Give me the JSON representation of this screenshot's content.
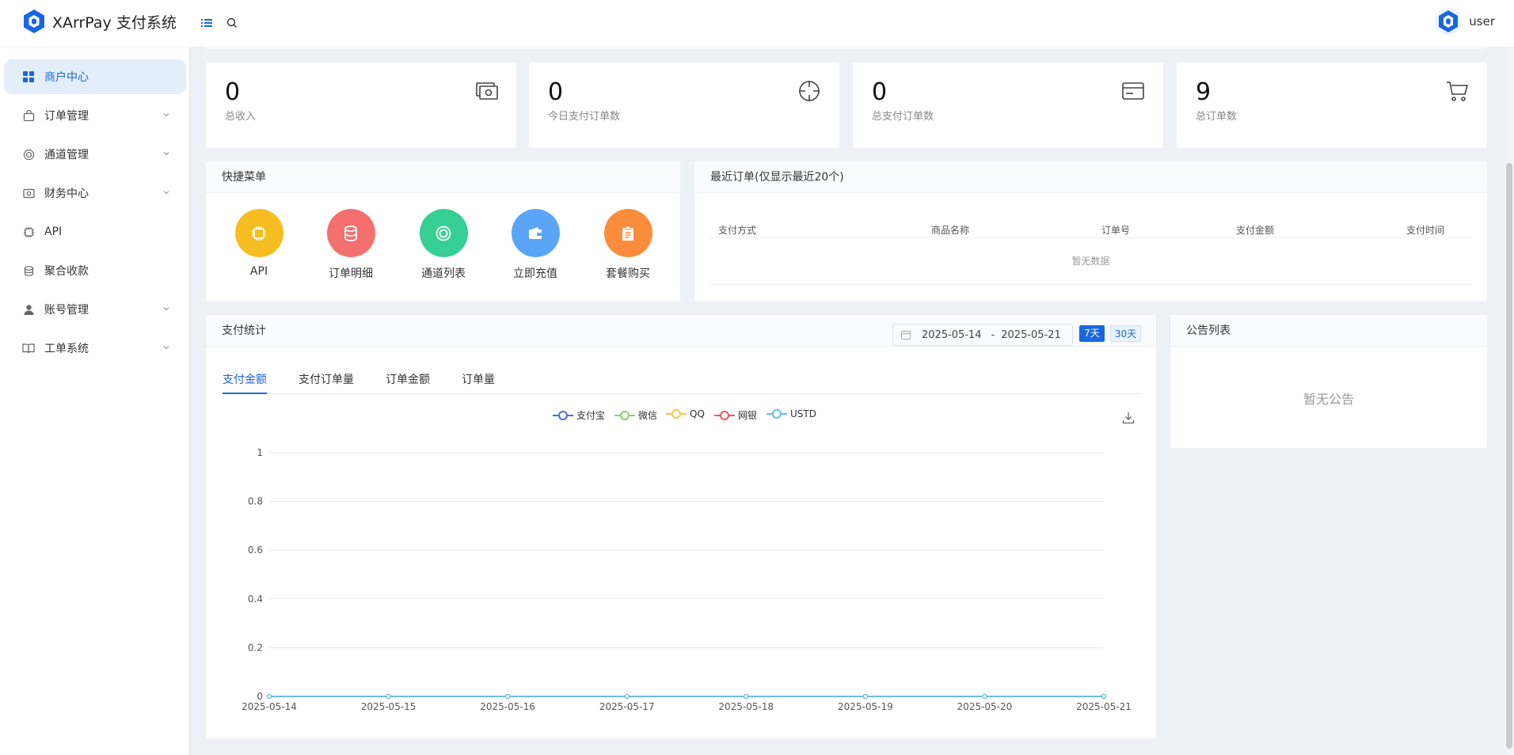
{
  "app": {
    "title": "XArrPay 支付系统",
    "user": "user",
    "brand_color": "#1a66e0"
  },
  "sidebar": {
    "items": [
      {
        "label": "商户中心",
        "icon": "grid-icon",
        "active": true
      },
      {
        "label": "订单管理",
        "icon": "bag-icon",
        "has_children": true
      },
      {
        "label": "通道管理",
        "icon": "ring-icon",
        "has_children": true
      },
      {
        "label": "财务中心",
        "icon": "money-icon",
        "has_children": true
      },
      {
        "label": "API",
        "icon": "chip-icon"
      },
      {
        "label": "聚合收款",
        "icon": "coins-icon"
      },
      {
        "label": "账号管理",
        "icon": "user-icon",
        "has_children": true
      },
      {
        "label": "工单系统",
        "icon": "book-icon",
        "has_children": true
      }
    ]
  },
  "stats": [
    {
      "value": "0",
      "label": "总收入",
      "icon": "money-stack-icon"
    },
    {
      "value": "0",
      "label": "今日支付订单数",
      "icon": "crosshair-icon"
    },
    {
      "value": "0",
      "label": "总支付订单数",
      "icon": "card-icon"
    },
    {
      "value": "9",
      "label": "总订单数",
      "icon": "cart-icon"
    }
  ],
  "quick_menu": {
    "title": "快捷菜单",
    "items": [
      {
        "label": "API",
        "color": "#f5bd1f",
        "icon": "chip-icon"
      },
      {
        "label": "订单明细",
        "color": "#f4706f",
        "icon": "database-icon"
      },
      {
        "label": "通道列表",
        "color": "#36cf96",
        "icon": "ring-icon"
      },
      {
        "label": "立即充值",
        "color": "#5ba5f8",
        "icon": "wallet-icon"
      },
      {
        "label": "套餐购买",
        "color": "#fb8c3b",
        "icon": "clipboard-icon"
      }
    ]
  },
  "recent_orders": {
    "title": "最近订单(仅显示最近20个)",
    "columns": [
      "支付方式",
      "商品名称",
      "订单号",
      "支付金额",
      "支付时间"
    ],
    "empty_text": "暂无数据"
  },
  "pay_stats": {
    "title": "支付统计",
    "date_start": "2025-05-14",
    "date_sep": "-",
    "date_end": "2025-05-21",
    "btn_7": "7天",
    "btn_30": "30天",
    "tabs": [
      "支付金额",
      "支付订单量",
      "订单金额",
      "订单量"
    ],
    "active_tab": 0
  },
  "notice": {
    "title": "公告列表",
    "empty_text": "暂无公告"
  },
  "chart_data": {
    "type": "line",
    "x": [
      "2025-05-14",
      "2025-05-15",
      "2025-05-16",
      "2025-05-17",
      "2025-05-18",
      "2025-05-19",
      "2025-05-20",
      "2025-05-21"
    ],
    "series": [
      {
        "name": "支付宝",
        "color": "#4a6fd4",
        "values": [
          0,
          0,
          0,
          0,
          0,
          0,
          0,
          0
        ]
      },
      {
        "name": "微信",
        "color": "#8fcf60",
        "values": [
          0,
          0,
          0,
          0,
          0,
          0,
          0,
          0
        ]
      },
      {
        "name": "QQ",
        "color": "#f7c548",
        "values": [
          0,
          0,
          0,
          0,
          0,
          0,
          0,
          0
        ]
      },
      {
        "name": "网银",
        "color": "#ec5a5a",
        "values": [
          0,
          0,
          0,
          0,
          0,
          0,
          0,
          0
        ]
      },
      {
        "name": "USTD",
        "color": "#6abfdf",
        "values": [
          0,
          0,
          0,
          0,
          0,
          0,
          0,
          0
        ]
      }
    ],
    "yticks": [
      "0",
      "0.2",
      "0.4",
      "0.6",
      "0.8",
      "1"
    ],
    "ylim": [
      0,
      1
    ],
    "grid": true,
    "legend": "top-center"
  }
}
